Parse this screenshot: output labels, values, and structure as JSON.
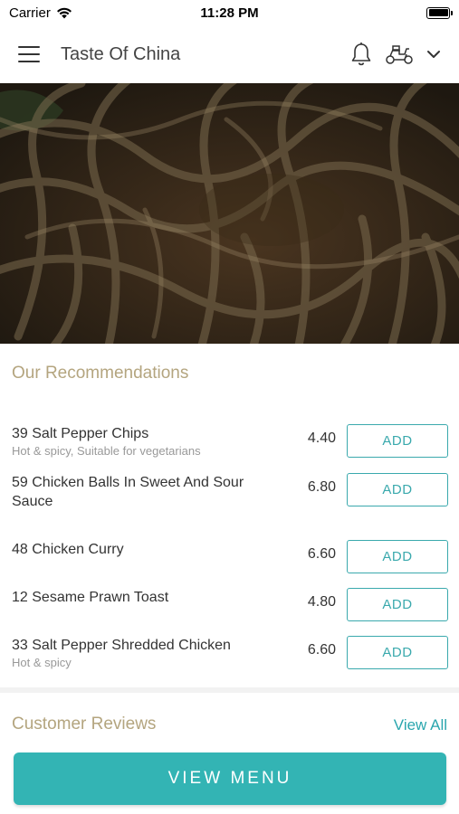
{
  "status_bar": {
    "carrier": "Carrier",
    "time": "11:28 PM"
  },
  "header": {
    "title": "Taste Of China",
    "icons": [
      "menu-icon",
      "bell-icon",
      "scooter-icon",
      "chevron-down-icon"
    ]
  },
  "recommendations": {
    "title": "Our Recommendations",
    "add_label": "ADD",
    "items": [
      {
        "name": "39 Salt Pepper Chips",
        "desc": "Hot & spicy, Suitable for vegetarians",
        "price": "4.40"
      },
      {
        "name": "59 Chicken Balls In Sweet And Sour Sauce",
        "desc": "",
        "price": "6.80"
      },
      {
        "name": "48 Chicken Curry",
        "desc": "",
        "price": "6.60"
      },
      {
        "name": "12 Sesame Prawn Toast",
        "desc": "",
        "price": "4.80"
      },
      {
        "name": "33 Salt Pepper Shredded Chicken",
        "desc": "Hot & spicy",
        "price": "6.60"
      }
    ]
  },
  "reviews": {
    "title": "Customer Reviews",
    "view_all": "View All"
  },
  "footer": {
    "view_menu": "VIEW MENU"
  },
  "colors": {
    "accent": "#33b4b4",
    "section_title": "#b4a57f",
    "link": "#2aa6ae"
  }
}
